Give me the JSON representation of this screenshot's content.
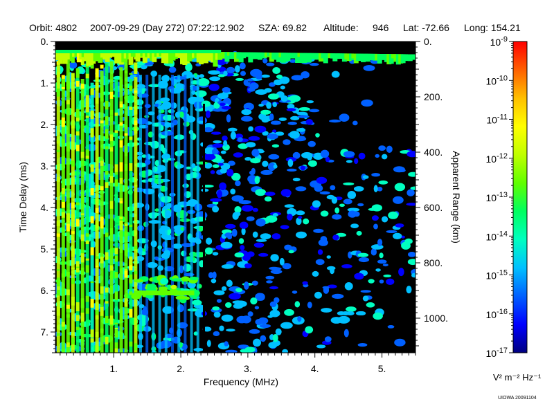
{
  "header": {
    "orbit": "Orbit: 4802",
    "datetime": "2007-09-29 (Day 272) 07:22:12.902",
    "sza": "SZA:  69.82",
    "altitude_label": "Altitude:",
    "altitude_value": "946",
    "lat": "Lat: -72.66",
    "long": "Long: 154.21"
  },
  "footer": {
    "stamp": "UIOWA 20091104"
  },
  "colorbar": {
    "unit": "V² m⁻² Hz⁻¹",
    "tick_base": "10",
    "tick_exponents": [
      "-9",
      "-10",
      "-11",
      "-12",
      "-13",
      "-14",
      "-15",
      "-16",
      "-17"
    ],
    "colors": [
      "#000080",
      "#0000ff",
      "#0060ff",
      "#00c0ff",
      "#00ffc0",
      "#00ff60",
      "#60ff00",
      "#c0ff00",
      "#ffff00",
      "#ffc000",
      "#ff6000",
      "#ff0000"
    ]
  },
  "chart_data": {
    "type": "heatmap",
    "xlabel": "Frequency (MHz)",
    "ylabel": "Time Delay (ms)",
    "y2label": "Apparent Range (km)",
    "xlim": [
      0.13,
      5.5
    ],
    "ylim": [
      7.5,
      0
    ],
    "xticks": [
      1,
      2,
      3,
      4,
      5
    ],
    "xtick_labels": [
      "1.",
      "2.",
      "3.",
      "4.",
      "5."
    ],
    "yticks": [
      0,
      1,
      2,
      3,
      4,
      5,
      6,
      7
    ],
    "ytick_labels": [
      "0.",
      "1.",
      "2.",
      "3.",
      "4.",
      "5.",
      "6.",
      "7."
    ],
    "y2ticks_km": [
      0,
      200,
      400,
      600,
      800,
      1000
    ],
    "y2tick_labels": [
      "0.",
      "200.",
      "400.",
      "600.",
      "800.",
      "1000."
    ],
    "colorscale": {
      "min_exp": -17,
      "max_exp": -9
    },
    "features": [
      {
        "name": "surface echo",
        "description": "strong return near 0.2 ms delay across all frequencies"
      },
      {
        "name": "low-frequency band",
        "description": "intense vertical streaks below about 1.3 MHz"
      },
      {
        "name": "noise field",
        "description": "speckled low-level signal between 1 and 5.5 MHz, fading toward high frequency and long delay"
      }
    ]
  }
}
